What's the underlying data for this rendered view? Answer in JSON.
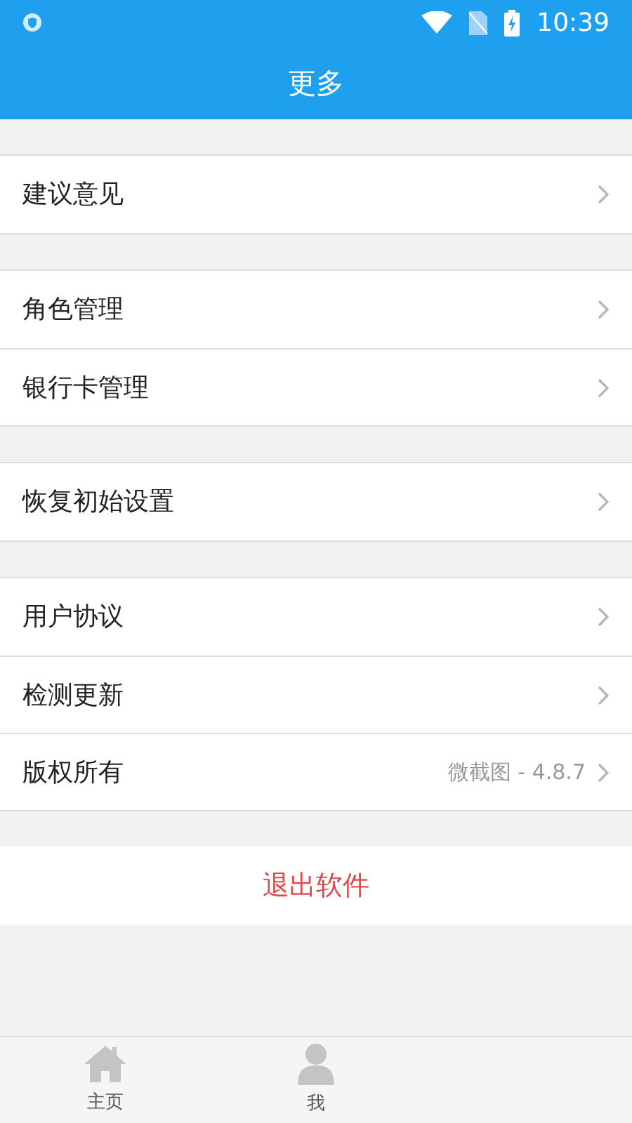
{
  "status_bar": {
    "time": "10:39"
  },
  "title": "更多",
  "groups": [
    {
      "items": [
        {
          "label": "建议意见"
        }
      ]
    },
    {
      "items": [
        {
          "label": "角色管理"
        },
        {
          "label": "银行卡管理"
        }
      ]
    },
    {
      "items": [
        {
          "label": "恢复初始设置"
        }
      ]
    },
    {
      "items": [
        {
          "label": "用户协议"
        },
        {
          "label": "检测更新"
        },
        {
          "label": "版权所有",
          "value": "微截图 - 4.8.7"
        }
      ]
    }
  ],
  "logout": "退出软件",
  "tabs": [
    {
      "label": "主页",
      "kind": "home"
    },
    {
      "label": "我",
      "kind": "profile"
    }
  ]
}
